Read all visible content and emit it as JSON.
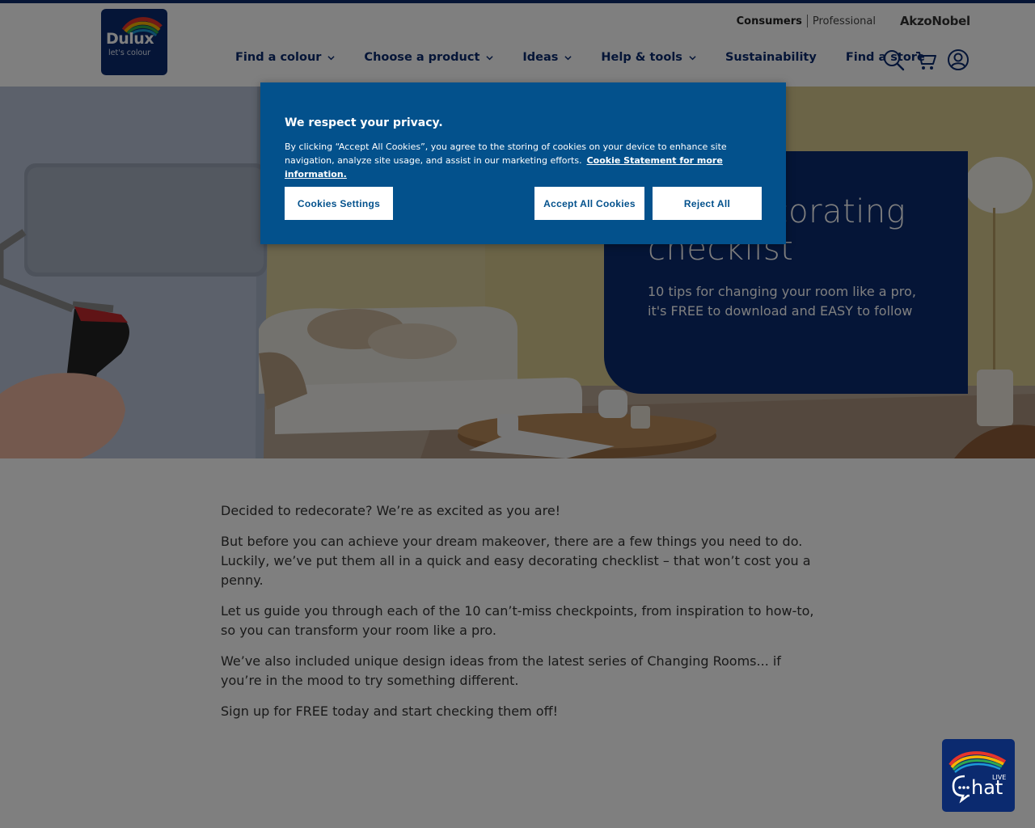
{
  "header": {
    "logo": {
      "word": "Dulux",
      "tagline": "let's colour"
    },
    "audience": {
      "active": "Consumers",
      "other": "Professional"
    },
    "partner_brand": "AkzoNobel",
    "nav": [
      {
        "label": "Find a colour",
        "has_dropdown": true
      },
      {
        "label": "Choose a product",
        "has_dropdown": true
      },
      {
        "label": "Ideas",
        "has_dropdown": true
      },
      {
        "label": "Help & tools",
        "has_dropdown": true
      },
      {
        "label": "Sustainability",
        "has_dropdown": false
      },
      {
        "label": "Find a store",
        "has_dropdown": false
      }
    ],
    "icons": [
      "search-icon",
      "cart-icon",
      "account-icon"
    ]
  },
  "hero": {
    "title": "Your decorating checklist",
    "subtitle": "10 tips for changing your room like a pro, it's FREE to download and EASY to follow"
  },
  "content": {
    "paragraphs": [
      "Decided to redecorate? We’re as excited as you are!",
      "But before you can achieve your dream makeover, there are a few things you need to do. Luckily, we’ve put them all in a quick and easy decorating checklist – that won’t cost you a penny.",
      "Let us guide you through each of the 10 can’t-miss checkpoints, from inspiration to how-to, so you can transform your room like a pro.",
      "We’ve also included unique design ideas from the latest series of Changing Rooms... if you’re in the mood to try something different.",
      "Sign up for FREE today and start checking them off!"
    ]
  },
  "cookie_banner": {
    "title": "We respect your privacy.",
    "body": "By clicking “Accept All Cookies”, you agree to the storing of cookies on your device to enhance site navigation, analyze site usage, and assist in our marketing efforts.",
    "link": "Cookie Statement for more information.",
    "buttons": {
      "settings": "Cookies Settings",
      "accept": "Accept All Cookies",
      "reject": "Reject All"
    }
  },
  "chat": {
    "badge": "LIVE",
    "label": "Chat"
  },
  "colors": {
    "brand_navy": "#0b2a6f",
    "cookie_blue": "#03518c",
    "overlay": "rgba(0,0,0,0.5)"
  }
}
